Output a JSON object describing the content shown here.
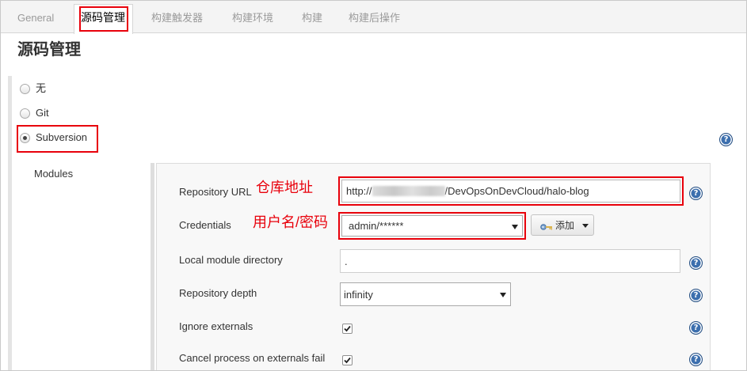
{
  "tabs": [
    {
      "label": "General",
      "active": false
    },
    {
      "label": "源码管理",
      "active": true
    },
    {
      "label": "构建触发器",
      "active": false
    },
    {
      "label": "构建环境",
      "active": false
    },
    {
      "label": "构建",
      "active": false
    },
    {
      "label": "构建后操作",
      "active": false
    }
  ],
  "section": {
    "title": "源码管理"
  },
  "scm": {
    "options": [
      {
        "label": "无",
        "selected": false
      },
      {
        "label": "Git",
        "selected": false
      },
      {
        "label": "Subversion",
        "selected": true
      }
    ]
  },
  "modules": {
    "label": "Modules",
    "repository_url": {
      "label": "Repository URL",
      "value_start": "http://",
      "value_end": "/DevOpsOnDevCloud/halo-blog",
      "annotation": "仓库地址"
    },
    "credentials": {
      "label": "Credentials",
      "value": "admin/******",
      "annotation": "用户名/密码",
      "add_button": "添加"
    },
    "local_module_directory": {
      "label": "Local module directory",
      "value": "."
    },
    "repository_depth": {
      "label": "Repository depth",
      "value": "infinity"
    },
    "ignore_externals": {
      "label": "Ignore externals",
      "checked": true
    },
    "cancel_process_on_externals_fail": {
      "label": "Cancel process on externals fail",
      "checked": true
    }
  },
  "icons": {
    "help": "help-icon",
    "key": "key-icon",
    "dropdown": "caret-down-icon",
    "check": "checkmark-icon"
  },
  "colors": {
    "highlight": "#e8000b",
    "help": "#3c6fae",
    "tab_inactive": "#9a9a9a",
    "panel_bg": "#f8f8f8"
  }
}
